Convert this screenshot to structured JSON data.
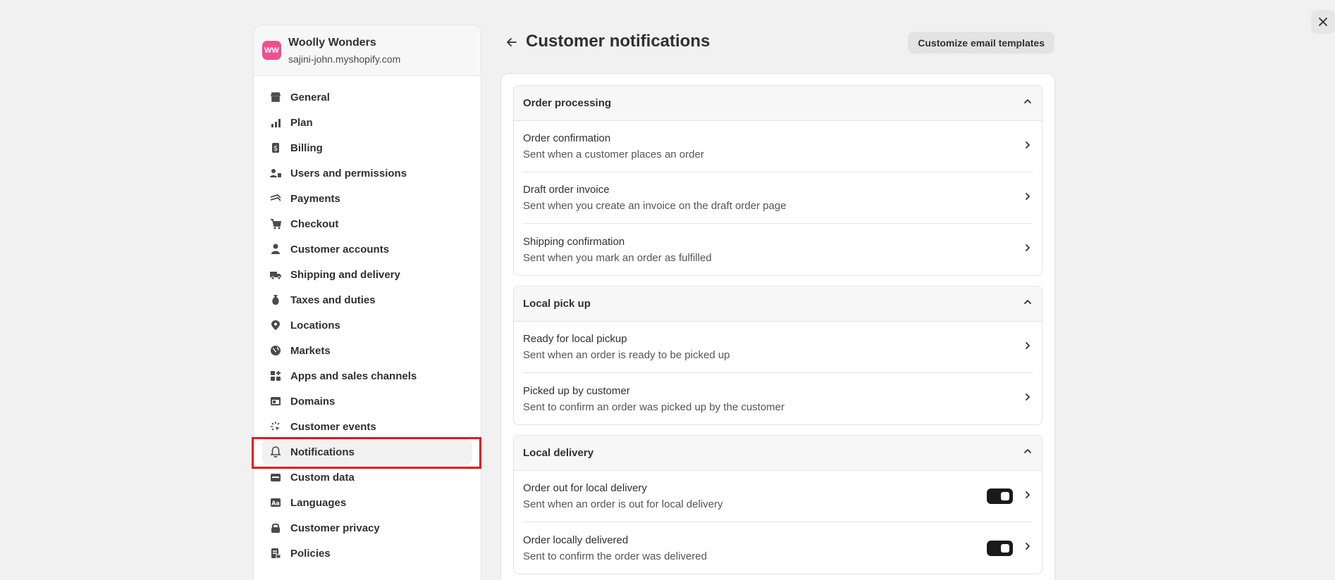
{
  "store": {
    "initials": "WW",
    "name": "Woolly Wonders",
    "domain": "sajini-john.myshopify.com"
  },
  "sidebar": {
    "items": [
      {
        "label": "General",
        "icon": "store-icon"
      },
      {
        "label": "Plan",
        "icon": "plan-icon"
      },
      {
        "label": "Billing",
        "icon": "billing-icon"
      },
      {
        "label": "Users and permissions",
        "icon": "users-icon"
      },
      {
        "label": "Payments",
        "icon": "payments-icon"
      },
      {
        "label": "Checkout",
        "icon": "cart-icon"
      },
      {
        "label": "Customer accounts",
        "icon": "person-icon"
      },
      {
        "label": "Shipping and delivery",
        "icon": "truck-icon"
      },
      {
        "label": "Taxes and duties",
        "icon": "tax-icon"
      },
      {
        "label": "Locations",
        "icon": "location-icon"
      },
      {
        "label": "Markets",
        "icon": "globe-icon"
      },
      {
        "label": "Apps and sales channels",
        "icon": "apps-icon"
      },
      {
        "label": "Domains",
        "icon": "domain-icon"
      },
      {
        "label": "Customer events",
        "icon": "cursor-icon"
      },
      {
        "label": "Notifications",
        "icon": "bell-icon"
      },
      {
        "label": "Custom data",
        "icon": "database-icon"
      },
      {
        "label": "Languages",
        "icon": "language-icon"
      },
      {
        "label": "Customer privacy",
        "icon": "lock-icon"
      },
      {
        "label": "Policies",
        "icon": "policy-icon"
      }
    ],
    "active_index": 14
  },
  "header": {
    "title": "Customer notifications",
    "customize_label": "Customize email templates"
  },
  "sections": [
    {
      "title": "Order processing",
      "rows": [
        {
          "title": "Order confirmation",
          "desc": "Sent when a customer places an order",
          "toggle": false
        },
        {
          "title": "Draft order invoice",
          "desc": "Sent when you create an invoice on the draft order page",
          "toggle": false
        },
        {
          "title": "Shipping confirmation",
          "desc": "Sent when you mark an order as fulfilled",
          "toggle": false
        }
      ]
    },
    {
      "title": "Local pick up",
      "rows": [
        {
          "title": "Ready for local pickup",
          "desc": "Sent when an order is ready to be picked up",
          "toggle": false
        },
        {
          "title": "Picked up by customer",
          "desc": "Sent to confirm an order was picked up by the customer",
          "toggle": false
        }
      ]
    },
    {
      "title": "Local delivery",
      "rows": [
        {
          "title": "Order out for local delivery",
          "desc": "Sent when an order is out for local delivery",
          "toggle": true
        },
        {
          "title": "Order locally delivered",
          "desc": "Sent to confirm the order was delivered",
          "toggle": true
        }
      ]
    }
  ],
  "colors": {
    "avatar_bg": "#ee4f8f",
    "highlight": "#e8101e",
    "toggle_on": "#1a1a1a"
  }
}
